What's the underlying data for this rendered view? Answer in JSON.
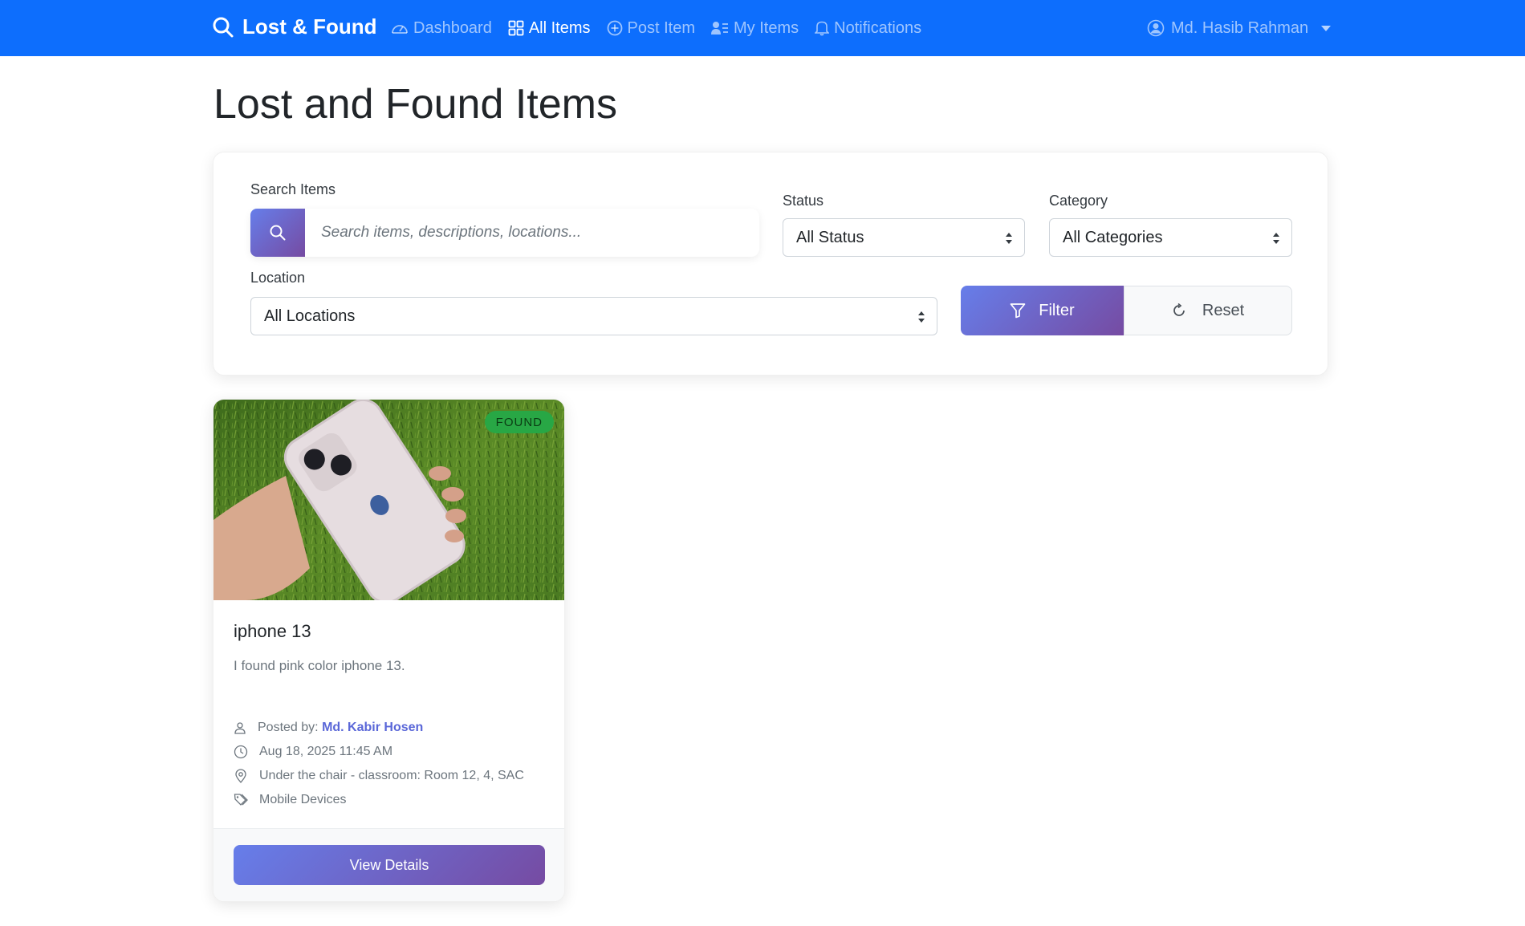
{
  "navbar": {
    "brand": "Lost & Found",
    "items": [
      {
        "label": "Dashboard",
        "icon": "speedometer-icon",
        "active": false
      },
      {
        "label": "All Items",
        "icon": "grid-icon",
        "active": true
      },
      {
        "label": "Post Item",
        "icon": "plus-circle-icon",
        "active": false
      },
      {
        "label": "My Items",
        "icon": "person-lines-icon",
        "active": false
      },
      {
        "label": "Notifications",
        "icon": "bell-icon",
        "active": false
      }
    ],
    "user_name": "Md. Hasib Rahman"
  },
  "page": {
    "title": "Lost and Found Items"
  },
  "filters": {
    "search_label": "Search Items",
    "search_placeholder": "Search items, descriptions, locations...",
    "status_label": "Status",
    "status_value": "All Status",
    "category_label": "Category",
    "category_value": "All Categories",
    "location_label": "Location",
    "location_value": "All Locations",
    "filter_button": "Filter",
    "reset_button": "Reset"
  },
  "items": [
    {
      "status_badge": "FOUND",
      "title": "iphone 13",
      "description": "I found pink color iphone 13.",
      "posted_by_label": "Posted by:",
      "posted_by": "Md. Kabir Hosen",
      "date": "Aug 18, 2025 11:45 AM",
      "location": "Under the chair - classroom: Room 12, 4, SAC",
      "category": "Mobile Devices",
      "action": "View Details"
    }
  ],
  "colors": {
    "navbar": "#0d6efd",
    "gradient_start": "#667eea",
    "gradient_end": "#764ba2",
    "found_badge": "#28a745"
  }
}
